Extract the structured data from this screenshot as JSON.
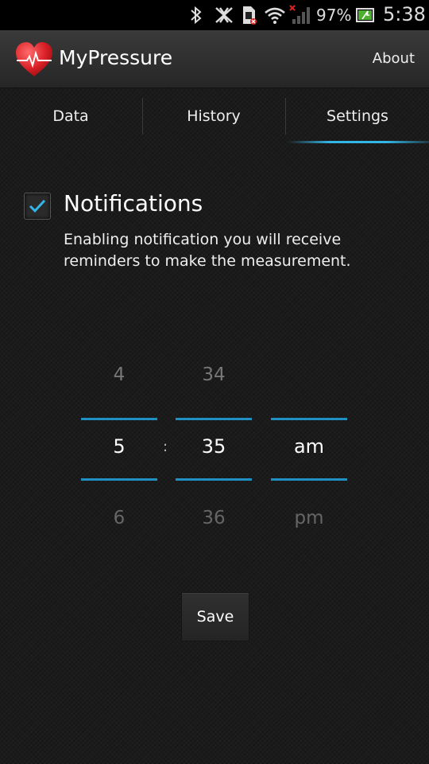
{
  "status_bar": {
    "icons": [
      "bluetooth-icon",
      "nfc-off-icon",
      "sim-error-icon",
      "wifi-icon",
      "signal-no-service-icon",
      "battery-charging-icon"
    ],
    "battery_percent": "97%",
    "time": "5:38"
  },
  "action_bar": {
    "title": "MyPressure",
    "about_label": "About",
    "logo": "heart-pulse-icon"
  },
  "tabs": [
    {
      "label": "Data",
      "selected": false
    },
    {
      "label": "History",
      "selected": false
    },
    {
      "label": "Settings",
      "selected": true
    }
  ],
  "accent_color": "#33b5e5",
  "notifications": {
    "checked": true,
    "title": "Notifications",
    "description": "Enabling notification you will receive reminders to make the measurement."
  },
  "time_picker": {
    "hour": {
      "prev": "4",
      "current": "5",
      "next": "6"
    },
    "separator": ":",
    "minute": {
      "prev": "34",
      "current": "35",
      "next": "36"
    },
    "ampm": {
      "prev": "",
      "current": "am",
      "next": "pm"
    }
  },
  "save_label": "Save"
}
